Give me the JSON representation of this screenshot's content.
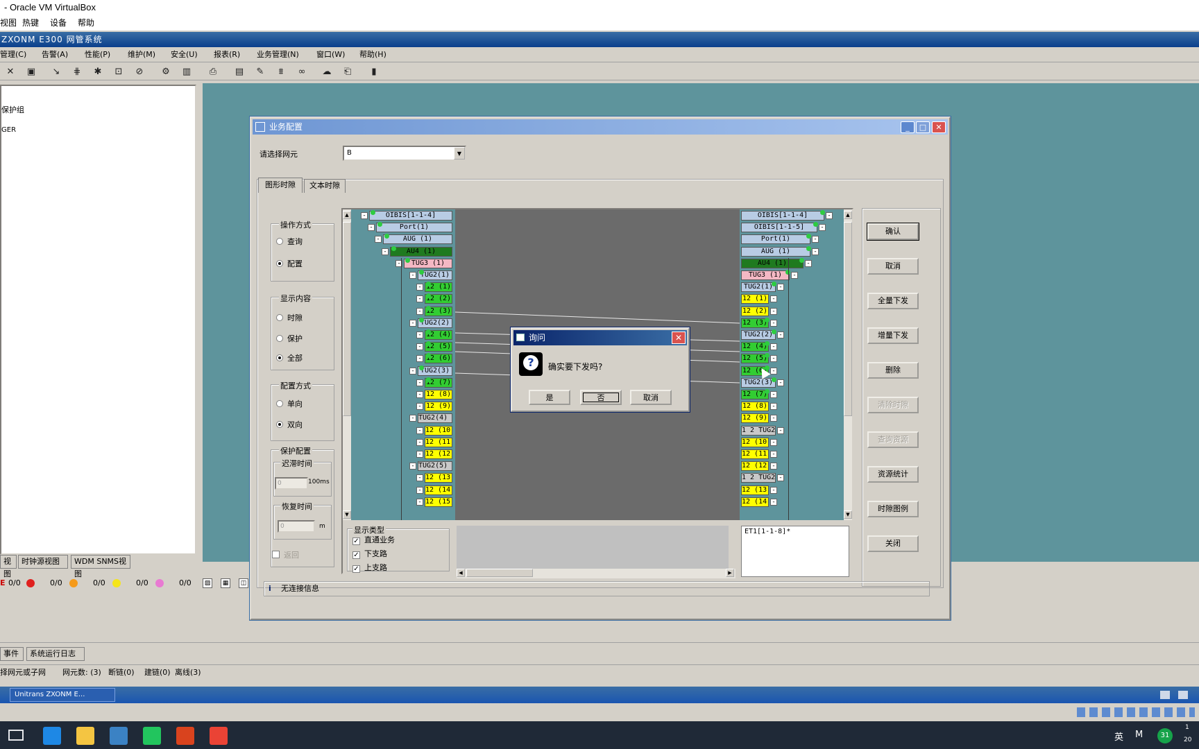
{
  "host": {
    "title": "- Oracle VM VirtualBox",
    "menu": [
      "视图",
      "热键",
      "设备",
      "帮助"
    ]
  },
  "app": {
    "title": "ZXONM E300 网管系统",
    "menu": [
      "管理(C)",
      "告警(A)",
      "性能(P)",
      "维护(M)",
      "安全(U)",
      "报表(R)",
      "业务管理(N)",
      "窗口(W)",
      "帮助(H)"
    ]
  },
  "left_tree": [
    "保护组",
    "GER"
  ],
  "left_tabs": [
    "视图",
    "时钟源视图",
    "WDM SNMS视图"
  ],
  "alarm_counts": [
    "0/0",
    "0/0",
    "0/0",
    "0/0",
    "0/0"
  ],
  "alarm_colors": [
    "#e0201e",
    "#f59a1a",
    "#f5e51a",
    "#e87ad2"
  ],
  "event_tabs": [
    "事件",
    "系统运行日志"
  ],
  "statusbar": {
    "hint": "择网元或子网",
    "ne_count": "网元数: (3)",
    "broken": "断链(0)",
    "linking": "建链(0)",
    "offline": "离线(3)"
  },
  "taskbar_item": "Unitrans ZXONM E...",
  "tray": {
    "ime": "英",
    "m": "M",
    "badge": "31",
    "clock_top": "1",
    "clock_bottom": "20"
  },
  "dialog": {
    "title": "业务配置",
    "ne_label": "请选择网元",
    "ne_value": "B",
    "tabs": [
      "图形时隙",
      "文本时隙"
    ],
    "op_group": "操作方式",
    "op_query": "查询",
    "op_config": "配置",
    "display_group": "显示内容",
    "disp_slot": "时隙",
    "disp_protect": "保护",
    "disp_all": "全部",
    "cfg_group": "配置方式",
    "cfg_uni": "单向",
    "cfg_bi": "双向",
    "prot_group": "保护配置",
    "delay_label": "迟滞时间",
    "delay_value": "0",
    "delay_unit": "100ms",
    "restore_label": "恢复时间",
    "restore_value": "0",
    "restore_unit": "m",
    "revert_label": "返回",
    "type_group": "显示类型",
    "type_direct": "直通业务",
    "type_drop": "下支路",
    "type_add": "上支路",
    "text_area": "ET1[1-1-8]*",
    "status": "无连接信息",
    "buttons": [
      "确认",
      "取消",
      "全量下发",
      "增量下发",
      "删除",
      "清除时隙",
      "查询资源",
      "资源统计",
      "时隙图例",
      "关闭"
    ],
    "left_tree": [
      {
        "label": "OIBIS[1-1-4]",
        "color": "blue"
      },
      {
        "label": "Port(1)",
        "color": "blue"
      },
      {
        "label": "AUG (1)",
        "color": "blue"
      },
      {
        "label": "AU4 (1)",
        "color": "dgreen"
      },
      {
        "label": "TUG3 (1)",
        "color": "pink"
      },
      {
        "label": "TUG2(1)",
        "color": "blue"
      },
      {
        "label": "12 (1)",
        "color": "green"
      },
      {
        "label": "12 (2)",
        "color": "green"
      },
      {
        "label": "12 (3)",
        "color": "green"
      },
      {
        "label": "TUG2(2)",
        "color": "blue"
      },
      {
        "label": "12 (4)",
        "color": "green"
      },
      {
        "label": "12 (5)",
        "color": "green"
      },
      {
        "label": "12 (6)",
        "color": "green"
      },
      {
        "label": "TUG2(3)",
        "color": "blue"
      },
      {
        "label": "12 (7)",
        "color": "green"
      },
      {
        "label": "12 (8)",
        "color": "yellow"
      },
      {
        "label": "12 (9)",
        "color": "yellow"
      },
      {
        "label": "TUG2(4) 2 1",
        "color": "gray"
      },
      {
        "label": "12 (10)",
        "color": "yellow"
      },
      {
        "label": "12 (11)",
        "color": "yellow"
      },
      {
        "label": "12 (12)",
        "color": "yellow"
      },
      {
        "label": "TUG2(5) 2 1",
        "color": "gray"
      },
      {
        "label": "12 (13)",
        "color": "yellow"
      },
      {
        "label": "12 (14)",
        "color": "yellow"
      },
      {
        "label": "12 (15)",
        "color": "yellow"
      }
    ],
    "right_tree": [
      {
        "label": "OIBIS[1-1-4]",
        "color": "blue"
      },
      {
        "label": "OIBIS[1-1-5]",
        "color": "blue"
      },
      {
        "label": "Port(1)",
        "color": "blue"
      },
      {
        "label": "AUG (1)",
        "color": "blue"
      },
      {
        "label": "AU4 (1)",
        "color": "dgreen"
      },
      {
        "label": "TUG3 (1)",
        "color": "pink"
      },
      {
        "label": "TUG2(1)",
        "color": "blue"
      },
      {
        "label": "12 (1)",
        "color": "yellow"
      },
      {
        "label": "12 (2)",
        "color": "yellow"
      },
      {
        "label": "12 (3)",
        "color": "green"
      },
      {
        "label": "TUG2(2)",
        "color": "blue"
      },
      {
        "label": "12 (4)",
        "color": "green"
      },
      {
        "label": "12 (5)",
        "color": "green"
      },
      {
        "label": "12 (6)",
        "color": "green"
      },
      {
        "label": "TUG2(3)",
        "color": "blue"
      },
      {
        "label": "12 (7)",
        "color": "green"
      },
      {
        "label": "12 (8)",
        "color": "yellow"
      },
      {
        "label": "12 (9)",
        "color": "yellow"
      },
      {
        "label": "1 2 TUG2(4)",
        "color": "gray"
      },
      {
        "label": "12 (10)",
        "color": "yellow"
      },
      {
        "label": "12 (11)",
        "color": "yellow"
      },
      {
        "label": "12 (12)",
        "color": "yellow"
      },
      {
        "label": "1 2 TUG2(5)",
        "color": "gray"
      },
      {
        "label": "12 (13)",
        "color": "yellow"
      },
      {
        "label": "12 (14)",
        "color": "yellow"
      }
    ]
  },
  "ask": {
    "title": "询问",
    "message": "确实要下发吗?",
    "yes": "是",
    "no": "否",
    "cancel": "取消"
  }
}
